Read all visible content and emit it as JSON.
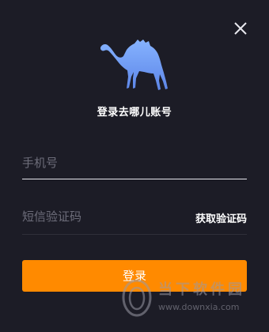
{
  "dialog": {
    "title": "登录去哪儿账号",
    "close_icon": "close-icon",
    "logo_icon": "camel-logo-icon"
  },
  "form": {
    "phone_placeholder": "手机号",
    "phone_value": "",
    "code_placeholder": "短信验证码",
    "code_value": "",
    "get_code_label": "获取验证码",
    "login_label": "登录"
  },
  "watermark": {
    "name": "当下软件园",
    "url": "www.downxia.com"
  },
  "colors": {
    "background": "#1c1c26",
    "accent": "#ff8a00",
    "logo_blue": "#6f9ff5",
    "text": "#ffffff",
    "placeholder": "#6d6d7a"
  }
}
